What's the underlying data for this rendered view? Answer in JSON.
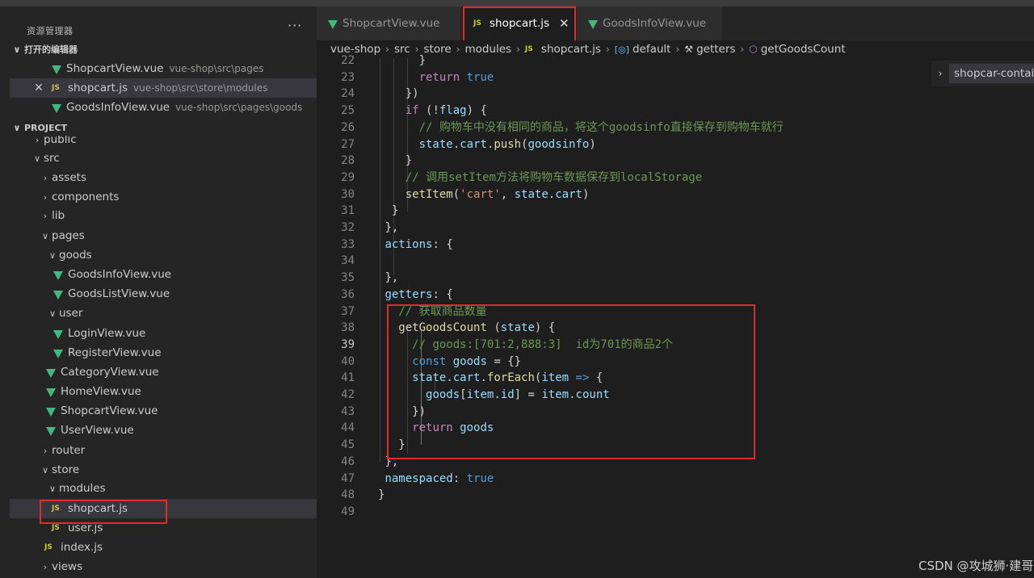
{
  "explorer": {
    "title": "资源管理器",
    "more": "···",
    "open_editors_label": "打开的编辑器",
    "project_label": "PROJECT",
    "open_editors": [
      {
        "name": "ShopcartView.vue",
        "path": "vue-shop\\src\\pages",
        "icon": "vue-icon"
      },
      {
        "name": "shopcart.js",
        "path": "vue-shop\\src\\store\\modules",
        "icon": "js-icon",
        "close": "✕"
      },
      {
        "name": "GoodsInfoView.vue",
        "path": "vue-shop\\src\\pages\\goods",
        "icon": "vue-icon"
      }
    ],
    "tree": [
      "public",
      "src",
      "assets",
      "components",
      "lib",
      "pages",
      "goods",
      "GoodsInfoView.vue",
      "GoodsListView.vue",
      "user",
      "LoginView.vue",
      "RegisterView.vue",
      "CategoryView.vue",
      "HomeView.vue",
      "ShopcartView.vue",
      "UserView.vue",
      "router",
      "store",
      "modules",
      "shopcart.js",
      "user.js",
      "index.js",
      "views"
    ]
  },
  "tabs": [
    "ShopcartView.vue",
    "shopcart.js",
    "GoodsInfoView.vue"
  ],
  "icons": {
    "js": "JS",
    "close": "✕"
  },
  "breadcrumb": [
    "vue-shop",
    "src",
    "store",
    "modules",
    "shopcart.js",
    "default",
    "getters",
    "getGoodsCount"
  ],
  "outline": {
    "label": "shopcar-container"
  },
  "code": [
    {
      "n": "22",
      "t": "      }"
    },
    {
      "n": "23",
      "t": "      return true"
    },
    {
      "n": "24",
      "t": "    })"
    },
    {
      "n": "25",
      "t": "    if (!flag) {"
    },
    {
      "n": "26",
      "t": "      // 购物车中没有相同的商品，将这个goodsinfo直接保存到购物车就行"
    },
    {
      "n": "27",
      "t": "      state.cart.push(goodsinfo)"
    },
    {
      "n": "28",
      "t": "    }"
    },
    {
      "n": "29",
      "t": "    // 调用setItem方法将购物车数据保存到localStorage"
    },
    {
      "n": "30",
      "t": "    setItem('cart', state.cart)"
    },
    {
      "n": "31",
      "t": "  }"
    },
    {
      "n": "32",
      "t": " },"
    },
    {
      "n": "33",
      "t": " actions: {"
    },
    {
      "n": "34",
      "t": ""
    },
    {
      "n": "35",
      "t": " },"
    },
    {
      "n": "36",
      "t": " getters: {"
    },
    {
      "n": "37",
      "t": "   // 获取商品数量"
    },
    {
      "n": "38",
      "t": "   getGoodsCount (state) {"
    },
    {
      "n": "39",
      "t": "     // goods:[701:2,888:3]  id为701的商品2个"
    },
    {
      "n": "40",
      "t": "     const goods = {}"
    },
    {
      "n": "41",
      "t": "     state.cart.forEach(item => {"
    },
    {
      "n": "42",
      "t": "       goods[item.id] = item.count"
    },
    {
      "n": "43",
      "t": "     })"
    },
    {
      "n": "44",
      "t": "     return goods"
    },
    {
      "n": "45",
      "t": "   }"
    },
    {
      "n": "46",
      "t": " },"
    },
    {
      "n": "47",
      "t": " namespaced: true"
    },
    {
      "n": "48",
      "t": "}"
    },
    {
      "n": "49",
      "t": ""
    }
  ],
  "watermark": "CSDN @攻城狮·建哥",
  "colors": {
    "highlight_box": "#e02b2b",
    "vue_icon": "#41b883",
    "js_icon": "#cbcb41"
  }
}
